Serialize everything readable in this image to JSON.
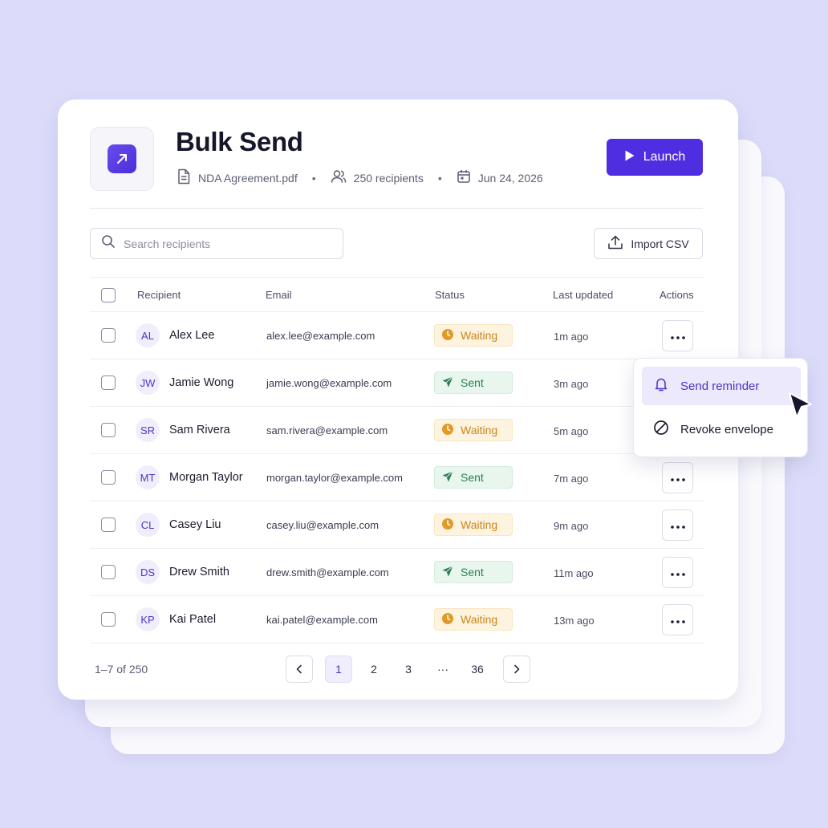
{
  "header": {
    "title": "Bulk Send",
    "file_name": "NDA Agreement.pdf",
    "recipients_count": "250 recipients",
    "date": "Jun 24, 2026",
    "separator": "•",
    "launch_label": "Launch"
  },
  "search": {
    "placeholder": "Search recipients",
    "value": ""
  },
  "import_label": "Import CSV",
  "table": {
    "columns": [
      "Recipient",
      "Email",
      "Status",
      "Last updated",
      "Actions"
    ],
    "rows": [
      {
        "initials": "AL",
        "name": "Alex Lee",
        "email": "alex.lee@example.com",
        "status": "Waiting",
        "updated": "1m ago"
      },
      {
        "initials": "JW",
        "name": "Jamie Wong",
        "email": "jamie.wong@example.com",
        "status": "Sent",
        "updated": "3m ago"
      },
      {
        "initials": "SR",
        "name": "Sam Rivera",
        "email": "sam.rivera@example.com",
        "status": "Waiting",
        "updated": "5m ago"
      },
      {
        "initials": "MT",
        "name": "Morgan Taylor",
        "email": "morgan.taylor@example.com",
        "status": "Sent",
        "updated": "7m ago"
      },
      {
        "initials": "CL",
        "name": "Casey Liu",
        "email": "casey.liu@example.com",
        "status": "Waiting",
        "updated": "9m ago"
      },
      {
        "initials": "DS",
        "name": "Drew Smith",
        "email": "drew.smith@example.com",
        "status": "Sent",
        "updated": "11m ago"
      },
      {
        "initials": "KP",
        "name": "Kai Patel",
        "email": "kai.patel@example.com",
        "status": "Waiting",
        "updated": "13m ago"
      }
    ]
  },
  "pagination": {
    "range": "1–7 of 250",
    "pages": [
      "1",
      "2",
      "3",
      "···",
      "36"
    ],
    "current": "1"
  },
  "menu": {
    "items": [
      {
        "label": "Send reminder",
        "icon": "bell-icon",
        "highlighted": true
      },
      {
        "label": "Revoke envelope",
        "icon": "ban-icon",
        "highlighted": false
      }
    ]
  },
  "colors": {
    "accent": "#4f2de0",
    "background": "#dcdcfa",
    "waiting": "#c9861f",
    "sent": "#2e7d56"
  }
}
